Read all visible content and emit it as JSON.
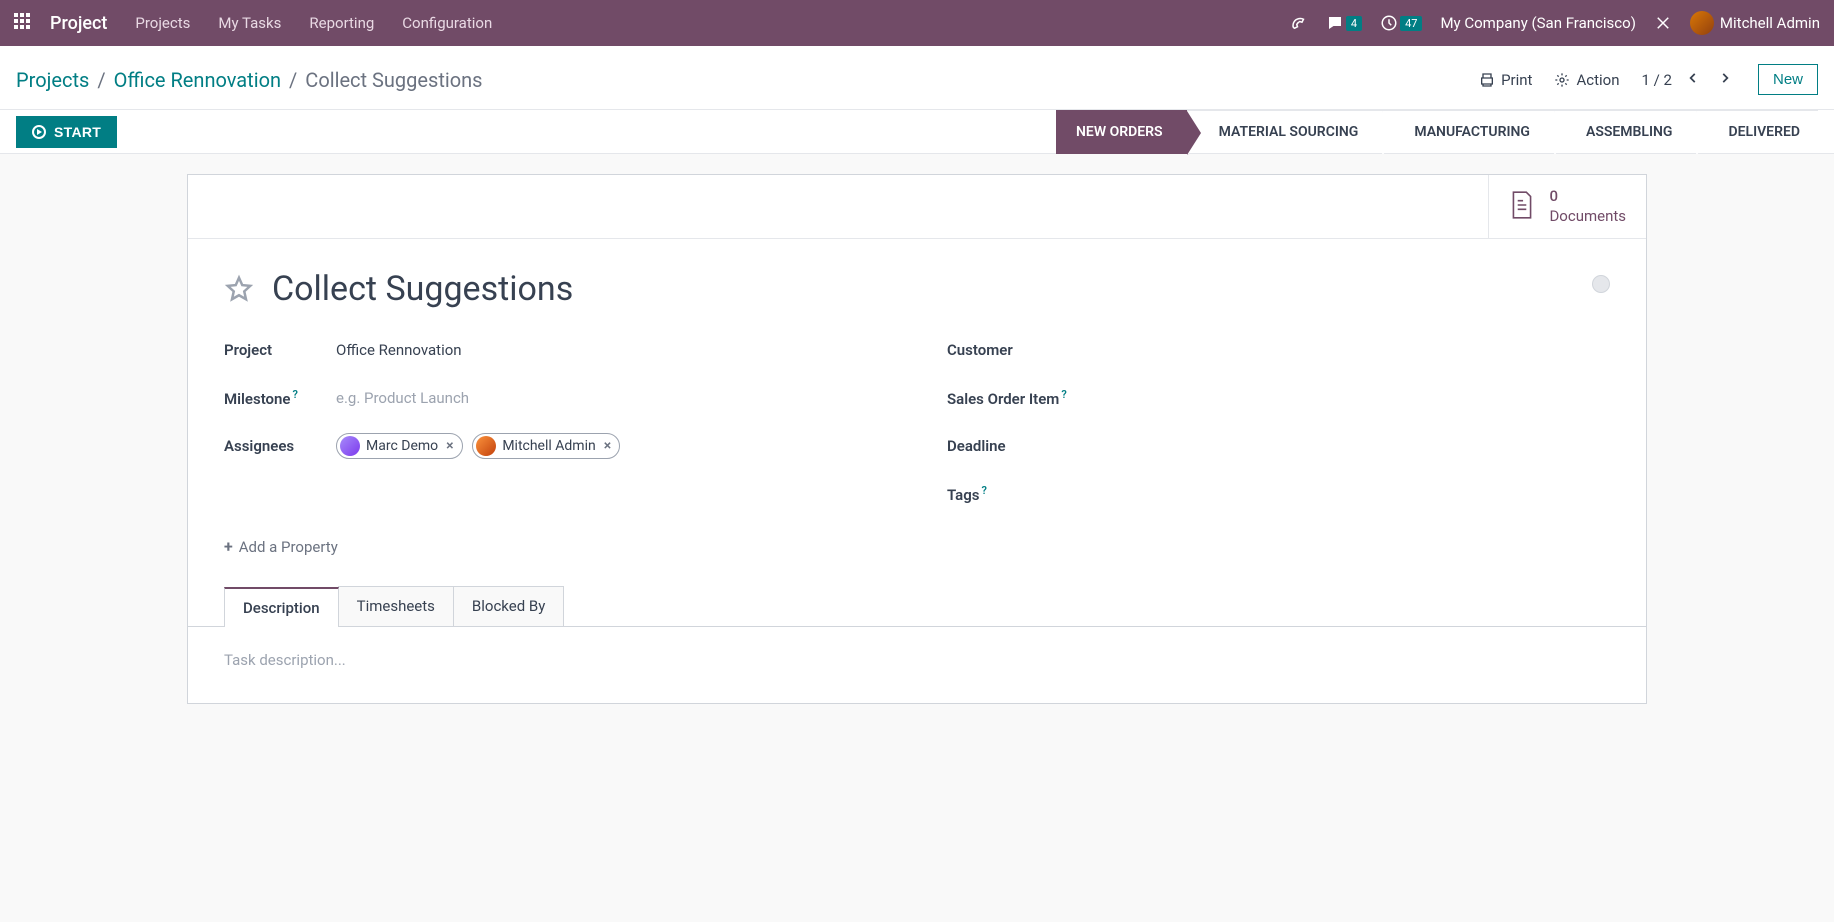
{
  "topbar": {
    "brand": "Project",
    "nav": [
      "Projects",
      "My Tasks",
      "Reporting",
      "Configuration"
    ],
    "messages_badge": "4",
    "activities_badge": "47",
    "company": "My Company (San Francisco)",
    "user": "Mitchell Admin"
  },
  "breadcrumb": {
    "root": "Projects",
    "project": "Office Rennovation",
    "current": "Collect Suggestions"
  },
  "controls": {
    "print": "Print",
    "action": "Action",
    "pager": "1 / 2",
    "new": "New"
  },
  "start_button": "START",
  "stages": [
    "NEW ORDERS",
    "MATERIAL SOURCING",
    "MANUFACTURING",
    "ASSEMBLING",
    "DELIVERED"
  ],
  "documents": {
    "count": "0",
    "label": "Documents"
  },
  "task": {
    "title": "Collect Suggestions",
    "labels": {
      "project": "Project",
      "milestone": "Milestone",
      "assignees": "Assignees",
      "customer": "Customer",
      "sales_order_item": "Sales Order Item",
      "deadline": "Deadline",
      "tags": "Tags",
      "add_property": "Add a Property"
    },
    "project_value": "Office Rennovation",
    "milestone_placeholder": "e.g. Product Launch",
    "assignees": [
      "Marc Demo",
      "Mitchell Admin"
    ]
  },
  "tabs": [
    "Description",
    "Timesheets",
    "Blocked By"
  ],
  "description_placeholder": "Task description..."
}
